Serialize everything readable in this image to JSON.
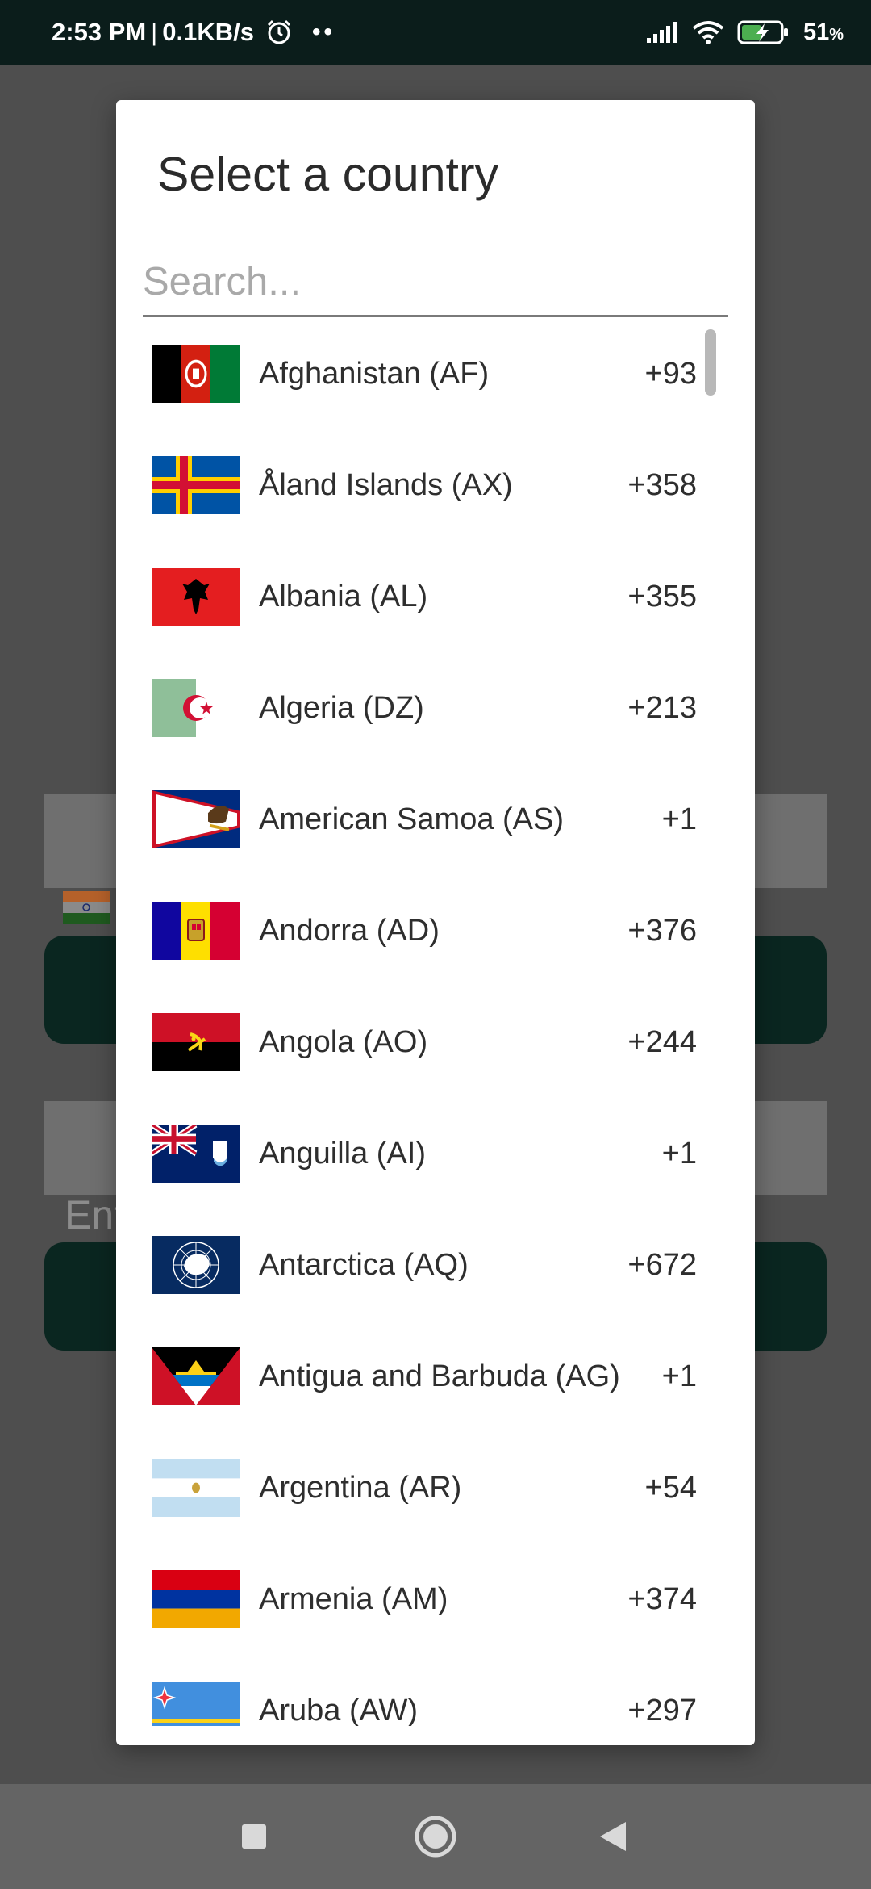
{
  "status_bar": {
    "time": "2:53 PM",
    "separator": "|",
    "speed": "0.1KB/s",
    "dots": "••",
    "battery_pct": "51",
    "battery_unit": "%",
    "icons": [
      "alarm-icon",
      "signal-icon",
      "wifi-icon",
      "battery-charging-icon"
    ]
  },
  "background": {
    "phone_placeholder_partial": "Ent",
    "colors": {
      "button": "#0a2620",
      "field": "#6f6f6f"
    }
  },
  "dialog": {
    "title": "Select a country",
    "search_placeholder": "Search..."
  },
  "countries": [
    {
      "name": "Afghanistan (AF)",
      "code": "+93",
      "flag": "af-flag"
    },
    {
      "name": "Åland Islands (AX)",
      "code": "+358",
      "flag": "ax-flag"
    },
    {
      "name": "Albania (AL)",
      "code": "+355",
      "flag": "al-flag"
    },
    {
      "name": "Algeria (DZ)",
      "code": "+213",
      "flag": "dz-flag"
    },
    {
      "name": "American Samoa (AS)",
      "code": "+1",
      "flag": "as-flag"
    },
    {
      "name": "Andorra (AD)",
      "code": "+376",
      "flag": "ad-flag"
    },
    {
      "name": "Angola (AO)",
      "code": "+244",
      "flag": "ao-flag"
    },
    {
      "name": "Anguilla (AI)",
      "code": "+1",
      "flag": "ai-flag"
    },
    {
      "name": "Antarctica (AQ)",
      "code": "+672",
      "flag": "aq-flag"
    },
    {
      "name": "Antigua and Barbuda (AG)",
      "code": "+1",
      "flag": "ag-flag"
    },
    {
      "name": "Argentina (AR)",
      "code": "+54",
      "flag": "ar-flag"
    },
    {
      "name": "Armenia (AM)",
      "code": "+374",
      "flag": "am-flag"
    },
    {
      "name": "Aruba (AW)",
      "code": "+297",
      "flag": "aw-flag"
    }
  ],
  "nav": {
    "icons": [
      "recents-square-icon",
      "home-circle-icon",
      "back-triangle-icon"
    ]
  }
}
